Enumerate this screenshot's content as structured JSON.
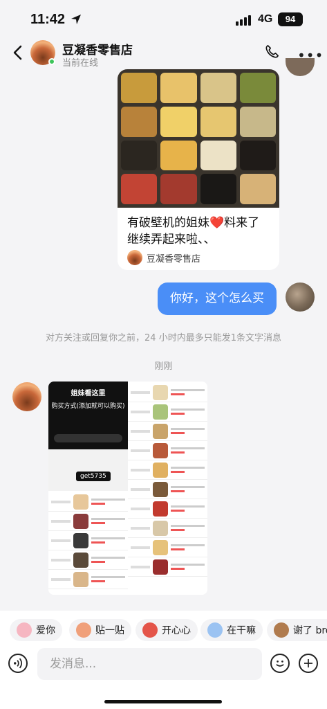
{
  "status_bar": {
    "time": "11:42",
    "network": "4G",
    "battery": "94"
  },
  "header": {
    "shop_name": "豆凝香零售店",
    "status": "当前在线"
  },
  "product_card": {
    "text": "有破壁机的姐妹❤️料来了 继续弄起来啦、、",
    "source": "豆凝香零售店"
  },
  "my_message": "你好，这个怎么买",
  "notice": "对方关注或回复你之前，24 小时内最多只能发1条文字消息",
  "timestamp": "刚刚",
  "image_message": {
    "title": "姐妹看这里",
    "subtitle": "购买方式(添加就可以购买)",
    "code": "get5735"
  },
  "quick_replies": [
    {
      "label": "爱你",
      "color": "#f6b6c1"
    },
    {
      "label": "贴一贴",
      "color": "#f0a07a"
    },
    {
      "label": "开心心",
      "color": "#e4554a"
    },
    {
      "label": "在干嘛",
      "color": "#9bc3f2"
    },
    {
      "label": "谢了 bro",
      "color": "#b07b4e"
    }
  ],
  "input": {
    "placeholder": "发消息..."
  }
}
